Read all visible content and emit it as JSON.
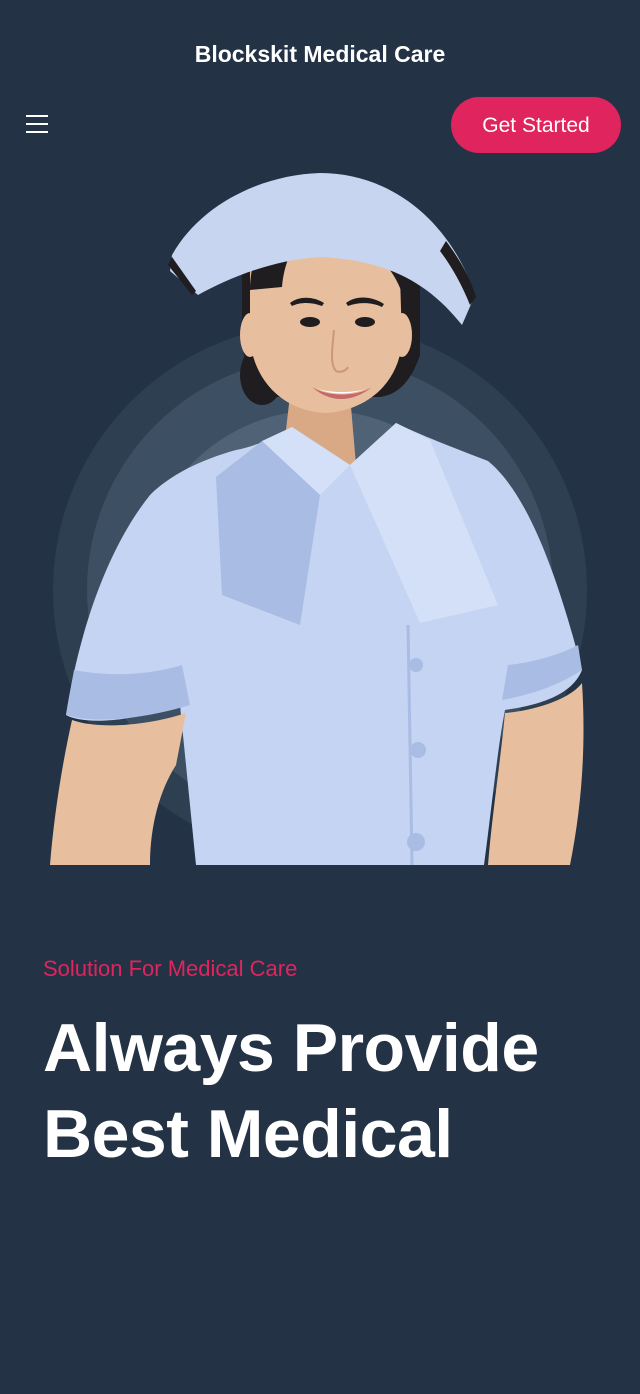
{
  "header": {
    "site_title": "Blockskit Medical Care",
    "menu_icon": "hamburger-menu-icon",
    "cta_label": "Get Started"
  },
  "hero": {
    "image_subject": "nurse-portrait",
    "eyebrow": "Solution For Medical Care",
    "headline": "Always Provide Best Medical"
  },
  "colors": {
    "background": "#233345",
    "accent": "#e0245e",
    "text": "#ffffff",
    "ring_outer": "#2e3f51",
    "ring_middle": "#3d4f62",
    "ring_inner": "#506376",
    "uniform": "#c5d4f2",
    "uniform_shadow": "#a9bce3",
    "skin": "#e8bf9e",
    "hair": "#1f1d1f"
  }
}
